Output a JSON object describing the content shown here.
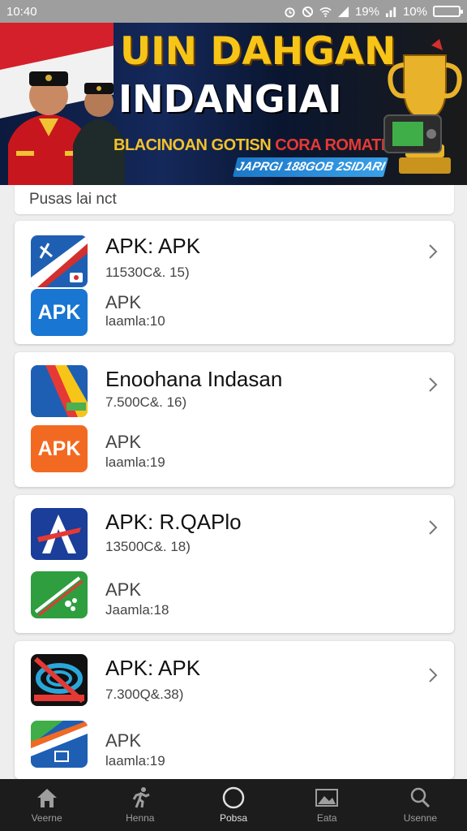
{
  "status_bar": {
    "time": "10:40",
    "signal_text": "19%",
    "battery_text": "10%"
  },
  "banner": {
    "title_line1": "UIN DAHGAN",
    "title_line2": "INDANGIAI",
    "subtitle_a": "BLACINOAN GOTISN",
    "subtitle_b": "CORA ROMATEII",
    "pill": "JAPRGI 188GOB 2SIDARI"
  },
  "search": {
    "placeholder": "Pusas lai nct"
  },
  "apps": [
    {
      "title": "APK: APK",
      "subtitle": "11530C&. 15)",
      "label2": "APK",
      "meta2": "laamla:10",
      "icon1": "blue-red-arrow-icon",
      "icon2": "apk-blue-icon",
      "icon2_text": "APK"
    },
    {
      "title": "Enoohana Indasan",
      "subtitle": "7.500C&. 16)",
      "label2": "APK",
      "meta2": "laamla:19",
      "icon1": "tricolor-flag-icon",
      "icon2": "apk-orange-icon",
      "icon2_text": "APK"
    },
    {
      "title": "APK: R.QAPlo",
      "subtitle": "13500C&. 18)",
      "label2": "APK",
      "meta2": "Jaamla:18",
      "icon1": "blue-letter-a-icon",
      "icon2": "green-card-icon",
      "icon2_text": ""
    },
    {
      "title": "APK: APK",
      "subtitle": "7.300Q&.38)",
      "label2": "APK",
      "meta2": "laamla:19",
      "icon1": "black-red-disc-icon",
      "icon2": "blue-green-wave-icon",
      "icon2_text": ""
    }
  ],
  "bottom_nav": [
    {
      "label": "Veerne",
      "icon": "home-icon"
    },
    {
      "label": "Henna",
      "icon": "run-icon"
    },
    {
      "label": "Pobsa",
      "icon": "circle-icon"
    },
    {
      "label": "Eata",
      "icon": "image-icon"
    },
    {
      "label": "Usenne",
      "icon": "search-icon"
    }
  ],
  "colors": {
    "accent_blue": "#1565c0",
    "apk_orange": "#f26a21",
    "banner_gold": "#f7c518",
    "nav_bg": "#1c1c1c"
  }
}
